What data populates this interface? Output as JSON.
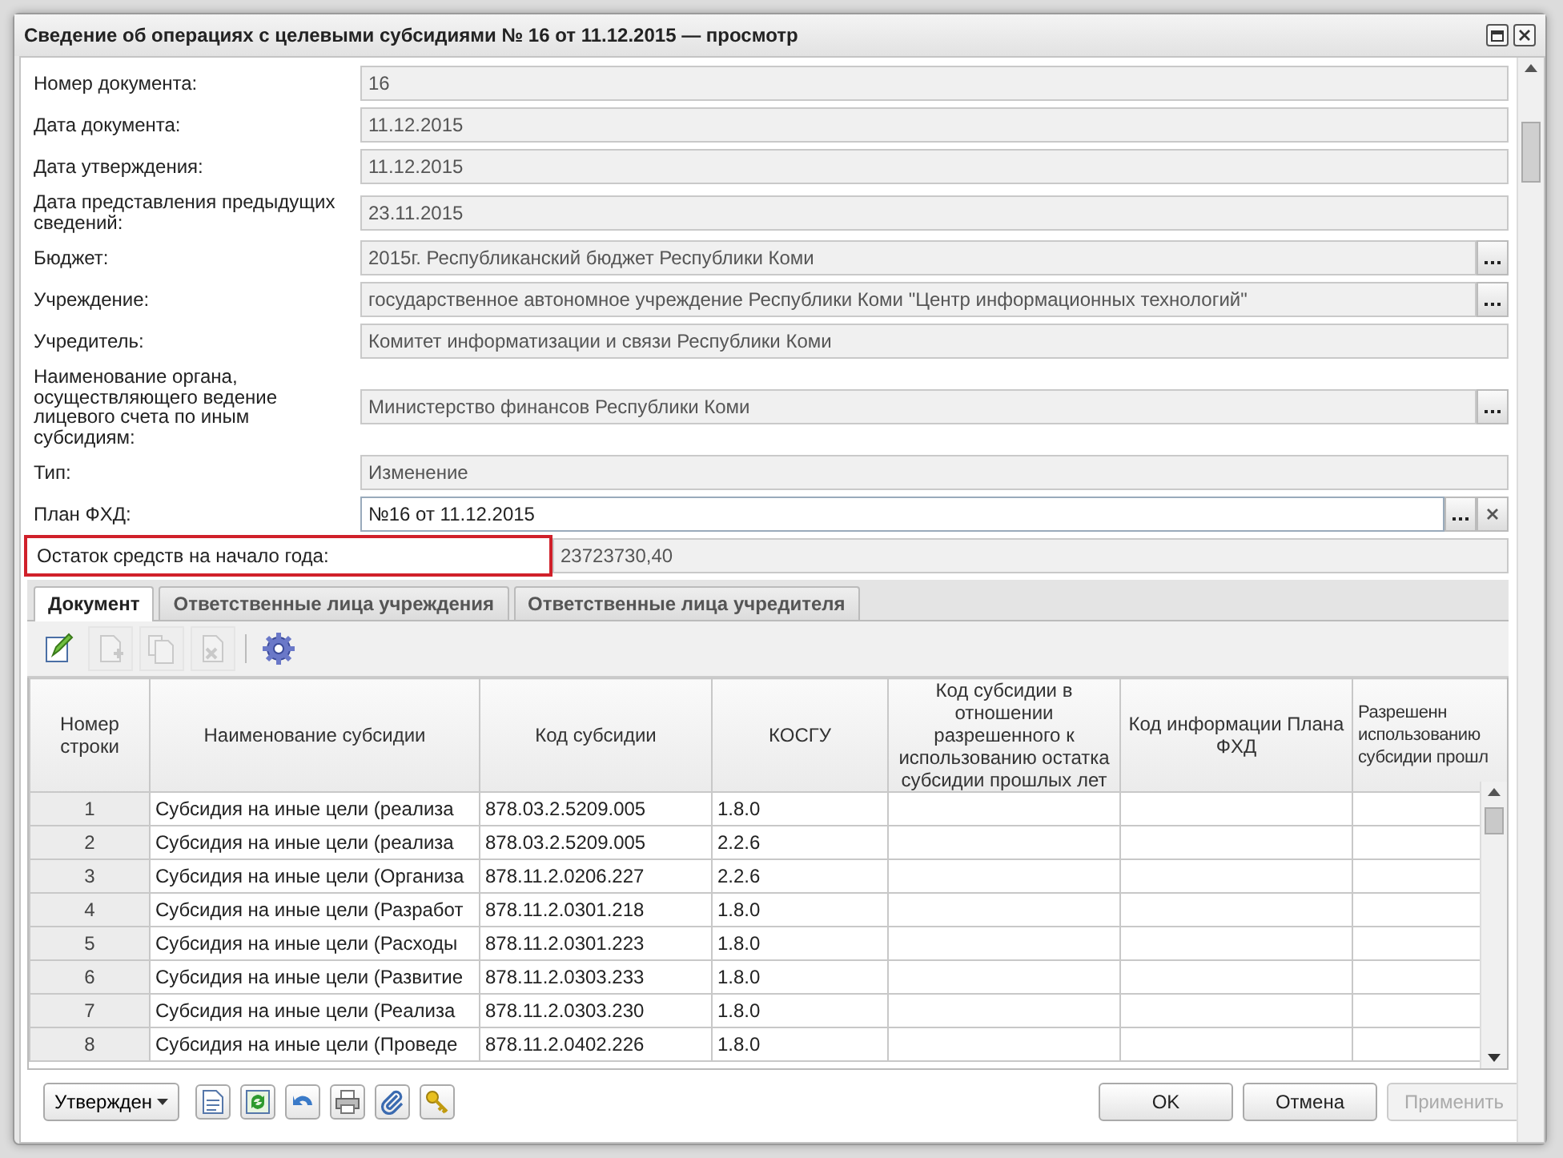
{
  "window": {
    "title": "Сведение об операциях с целевыми субсидиями № 16 от 11.12.2015 — просмотр"
  },
  "fields": [
    {
      "label": "Номер документа:",
      "value": "16",
      "kind": "text",
      "highlighted": false
    },
    {
      "label": "Дата документа:",
      "value": "11.12.2015",
      "kind": "text",
      "highlighted": false
    },
    {
      "label": "Дата утверждения:",
      "value": "11.12.2015",
      "kind": "text",
      "highlighted": false
    },
    {
      "label": "Дата представления предыдущих сведений:",
      "value": "23.11.2015",
      "kind": "text",
      "highlighted": false
    },
    {
      "label": "Бюджет:",
      "value": "2015г. Республиканский бюджет Республики Коми",
      "kind": "lookup",
      "highlighted": false
    },
    {
      "label": "Учреждение:",
      "value": "государственное автономное учреждение Республики Коми \"Центр информационных технологий\"",
      "kind": "lookup",
      "highlighted": false
    },
    {
      "label": "Учредитель:",
      "value": "Комитет информатизации и связи Республики Коми",
      "kind": "text",
      "highlighted": false
    },
    {
      "label": "Наименование органа, осуществляющего ведение лицевого счета по иным субсидиям:",
      "value": "Министерство финансов Республики Коми",
      "kind": "lookup",
      "highlighted": false
    },
    {
      "label": "Тип:",
      "value": "Изменение",
      "kind": "text",
      "highlighted": false
    },
    {
      "label": "План ФХД:",
      "value": "№16 от 11.12.2015",
      "kind": "picker",
      "highlighted": false
    },
    {
      "label": "Остаток средств на начало года:",
      "value": "23723730,40",
      "kind": "text",
      "highlighted": true
    }
  ],
  "tabs": [
    {
      "label": "Документ",
      "selected": true
    },
    {
      "label": "Ответственные лица учреждения",
      "selected": false
    },
    {
      "label": "Ответственные лица учредителя",
      "selected": false
    }
  ],
  "toolbar": [
    {
      "kind": "edit",
      "disabled": false
    },
    {
      "kind": "add",
      "disabled": true
    },
    {
      "kind": "copy",
      "disabled": true
    },
    {
      "kind": "delete",
      "disabled": true
    },
    {
      "kind": "settings",
      "disabled": false
    }
  ],
  "table": {
    "columns": [
      "Номер строки",
      "Наименование субсидии",
      "Код субсидии",
      "КОСГУ",
      "Код субсидии в отношении разрешенного к использованию остатка субсидии прошлых лет",
      "Код информации Плана ФХД",
      "Разрешенн\nиспользованию\nсубсидии прошл"
    ],
    "rows": [
      [
        "1",
        "Субсидия на иные цели (реализа",
        "878.03.2.5209.005",
        "1.8.0"
      ],
      [
        "2",
        "Субсидия на иные цели (реализа",
        "878.03.2.5209.005",
        "2.2.6"
      ],
      [
        "3",
        "Субсидия на иные цели (Организа",
        "878.11.2.0206.227",
        "2.2.6"
      ],
      [
        "4",
        "Субсидия на иные цели (Разработ",
        "878.11.2.0301.218",
        "1.8.0"
      ],
      [
        "5",
        "Субсидия на иные цели (Расходы",
        "878.11.2.0301.223",
        "1.8.0"
      ],
      [
        "6",
        "Субсидия на иные цели (Развитие",
        "878.11.2.0303.233",
        "1.8.0"
      ],
      [
        "7",
        "Субсидия на иные цели (Реализа",
        "878.11.2.0303.230",
        "1.8.0"
      ],
      [
        "8",
        "Субсидия на иные цели (Проведе",
        "878.11.2.0402.226",
        "1.8.0"
      ]
    ]
  },
  "footer": {
    "status": "Утвержден",
    "icons": [
      {
        "kind": "document"
      },
      {
        "kind": "refresh"
      },
      {
        "kind": "undo"
      },
      {
        "kind": "print"
      },
      {
        "kind": "attach"
      },
      {
        "kind": "key"
      }
    ],
    "buttons": [
      {
        "label": "OK",
        "disabled": false
      },
      {
        "label": "Отмена",
        "disabled": false
      },
      {
        "label": "Применить",
        "disabled": true
      }
    ]
  }
}
